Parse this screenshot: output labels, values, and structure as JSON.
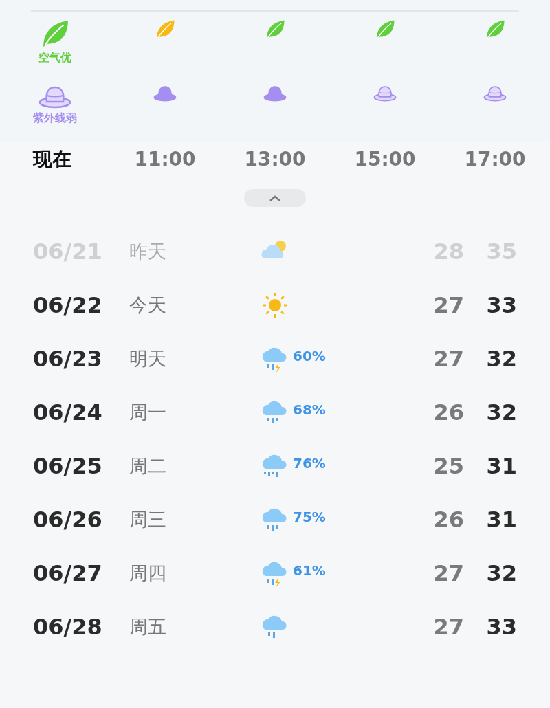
{
  "air_quality": [
    {
      "color": "#5fcf3c",
      "label": "空气优"
    },
    {
      "color": "#f7b916"
    },
    {
      "color": "#5fcf3c"
    },
    {
      "color": "#5fcf3c"
    },
    {
      "color": "#5fcf3c"
    }
  ],
  "uv_index": [
    {
      "kind": "outline",
      "label": "紫外线弱"
    },
    {
      "kind": "filled"
    },
    {
      "kind": "filled"
    },
    {
      "kind": "outline"
    },
    {
      "kind": "outline"
    }
  ],
  "hours": [
    {
      "time": "现在",
      "selected": true
    },
    {
      "time": "11:00",
      "selected": false
    },
    {
      "time": "13:00",
      "selected": false
    },
    {
      "time": "15:00",
      "selected": false
    },
    {
      "time": "17:00",
      "selected": false
    }
  ],
  "collapse_button": {
    "expanded": true
  },
  "daily": [
    {
      "date": "06/21",
      "day": "昨天",
      "kind": "partly-cloudy",
      "low": "28",
      "high": "35",
      "past": true
    },
    {
      "date": "06/22",
      "day": "今天",
      "kind": "sunny",
      "low": "27",
      "high": "33",
      "past": false
    },
    {
      "date": "06/23",
      "day": "明天",
      "kind": "thunderstorm",
      "precip": "60%",
      "low": "27",
      "high": "32",
      "past": false
    },
    {
      "date": "06/24",
      "day": "周一",
      "kind": "rain",
      "precip": "68%",
      "low": "26",
      "high": "32",
      "past": false
    },
    {
      "date": "06/25",
      "day": "周二",
      "kind": "heavy-rain",
      "precip": "76%",
      "low": "25",
      "high": "31",
      "past": false
    },
    {
      "date": "06/26",
      "day": "周三",
      "kind": "rain",
      "precip": "75%",
      "low": "26",
      "high": "31",
      "past": false
    },
    {
      "date": "06/27",
      "day": "周四",
      "kind": "thunderstorm",
      "precip": "61%",
      "low": "27",
      "high": "32",
      "past": false
    },
    {
      "date": "06/28",
      "day": "周五",
      "kind": "light-rain",
      "low": "27",
      "high": "33",
      "past": false
    }
  ]
}
